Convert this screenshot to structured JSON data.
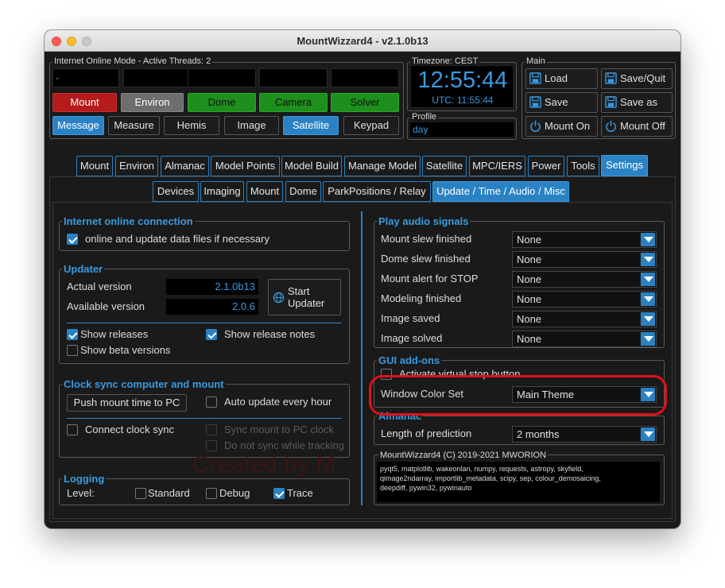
{
  "window": {
    "title": "MountWizzard4 - v2.1.0b13"
  },
  "status_panel": {
    "label": "Internet Online Mode  -  Active Threads:  2",
    "message_value": "-",
    "row1": [
      "Mount",
      "Environ",
      "Dome",
      "Camera",
      "Solver"
    ],
    "row2": [
      "Message",
      "Measure",
      "Hemis",
      "Image",
      "Satellite",
      "Keypad"
    ]
  },
  "timezone": {
    "label": "Timezone: CEST",
    "time": "12:55:44",
    "utc": "UTC:  11:55:44"
  },
  "profile": {
    "label": "Profile",
    "value": "day"
  },
  "main_panel": {
    "label": "Main",
    "load": "Load",
    "save_quit": "Save/Quit",
    "save": "Save",
    "save_as": "Save as",
    "mount_on": "Mount On",
    "mount_off": "Mount Off"
  },
  "main_tabs": [
    "Mount",
    "Environ",
    "Almanac",
    "Model Points",
    "Model Build",
    "Manage Model",
    "Satellite",
    "MPC/IERS",
    "Power",
    "Tools",
    "Settings"
  ],
  "sub_tabs": [
    "Devices",
    "Imaging",
    "Mount",
    "Dome",
    "ParkPositions / Relay",
    "Update / Time / Audio / Misc"
  ],
  "internet": {
    "title": "Internet online connection",
    "online_label": "online and update data files if necessary",
    "online_checked": true
  },
  "updater": {
    "title": "Updater",
    "actual_label": "Actual version",
    "actual_value": "2.1.0b13",
    "available_label": "Available version",
    "available_value": "2.0.6",
    "start_line1": "Start",
    "start_line2": "Updater",
    "show_releases": "Show releases",
    "show_release_notes": "Show release notes",
    "show_beta": "Show beta versions"
  },
  "clock": {
    "title": "Clock sync computer and mount",
    "push_button": "Push mount time to PC",
    "auto_update": "Auto update every hour",
    "connect_sync": "Connect clock sync",
    "sync_mount": "Sync mount to PC clock",
    "no_sync_tracking": "Do not sync while tracking"
  },
  "watermark": "Created by M",
  "logging": {
    "title": "Logging",
    "level_label": "Level:",
    "standard": "Standard",
    "debug": "Debug",
    "trace": "Trace"
  },
  "audio": {
    "title": "Play audio signals",
    "rows": [
      {
        "label": "Mount slew finished",
        "value": "None"
      },
      {
        "label": "Dome slew finished",
        "value": "None"
      },
      {
        "label": "Mount alert for STOP",
        "value": "None"
      },
      {
        "label": "Modeling finished",
        "value": "None"
      },
      {
        "label": "Image saved",
        "value": "None"
      },
      {
        "label": "Image solved",
        "value": "None"
      }
    ]
  },
  "gui_addons": {
    "title": "GUI add-ons",
    "virtual_stop": "Activate virtual stop button",
    "color_set_label": "Window Color Set",
    "color_set_value": "Main Theme"
  },
  "almanac": {
    "title": "Almanac",
    "prediction_label": "Length of prediction",
    "prediction_value": "2 months"
  },
  "about": {
    "title": "MountWizzard4 (C) 2019-2021 MWORION",
    "line1": "pyqt5, matplotlib, wakeonlan, numpy, requests, astropy, skyfield,",
    "line2": "qimage2ndarray, importlib_metadata, scipy, sep, colour_demosaicing,",
    "line3": "deepdiff, pywin32, pywinauto"
  },
  "colors": {
    "accent": "#2a82c4",
    "highlight_ring": "#e0101a",
    "alert_red": "#b51b1b",
    "ok_green": "#1d8f1d"
  }
}
